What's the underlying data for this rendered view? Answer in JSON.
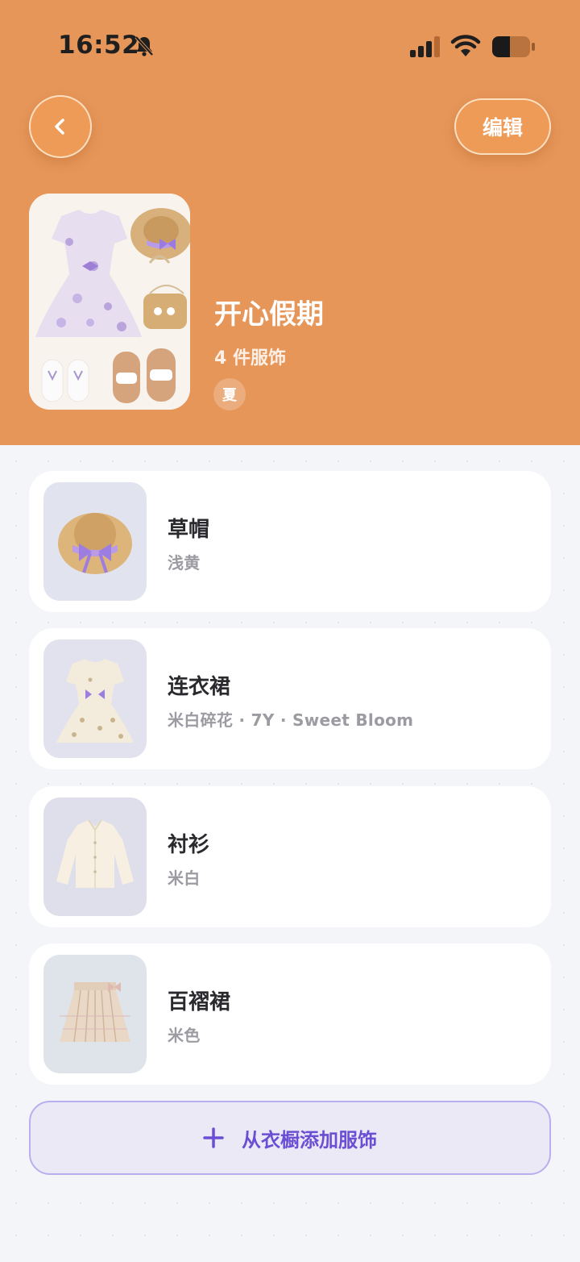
{
  "status_bar": {
    "time": "16:52"
  },
  "header": {
    "back_icon": "chevron-left-icon",
    "edit_label": "编辑",
    "outfit_title": "开心假期",
    "outfit_count": "4 件服饰",
    "season_tag": "夏"
  },
  "items": [
    {
      "name": "草帽",
      "meta": "浅黄",
      "thumb_bg": "#e1e4ef",
      "icon": "straw-hat-icon"
    },
    {
      "name": "连衣裙",
      "meta": "米白碎花 · 7Y · Sweet Bloom",
      "thumb_bg": "#e1e2ee",
      "icon": "dress-icon"
    },
    {
      "name": "衬衫",
      "meta": "米白",
      "thumb_bg": "#dfdfeb",
      "icon": "shirt-icon"
    },
    {
      "name": "百褶裙",
      "meta": "米色",
      "thumb_bg": "#dfe3ea",
      "icon": "pleated-skirt-icon"
    }
  ],
  "add_button": {
    "label": "从衣橱添加服饰",
    "icon": "plus-icon"
  },
  "colors": {
    "header_bg": "#e69659",
    "accent": "#6a4fd4",
    "page_bg": "#f4f5f8"
  }
}
